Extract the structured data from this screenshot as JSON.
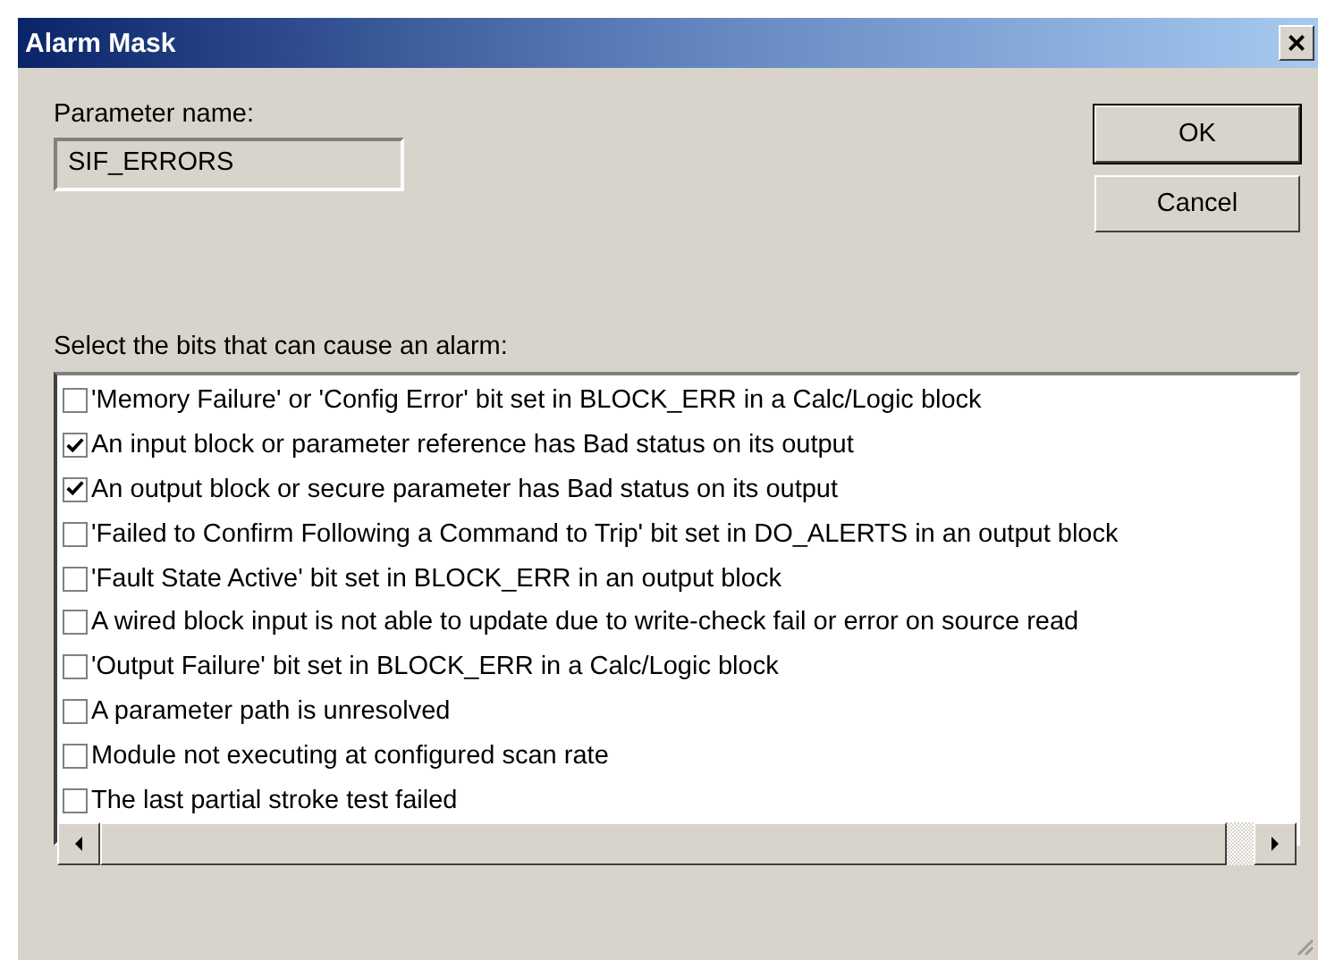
{
  "window": {
    "title": "Alarm Mask",
    "close": "×"
  },
  "parameter": {
    "label": "Parameter name:",
    "value": "SIF_ERRORS"
  },
  "buttons": [
    {
      "label": "OK",
      "default": true
    },
    {
      "label": "Cancel",
      "default": false
    }
  ],
  "bits": {
    "label": "Select the bits that can cause an alarm:",
    "items": [
      {
        "label": "'Memory Failure' or 'Config Error' bit set in BLOCK_ERR in a Calc/Logic block",
        "checked": false
      },
      {
        "label": "An input block or parameter reference has Bad status on its output",
        "checked": true
      },
      {
        "label": "An output block or secure parameter has Bad status on its output",
        "checked": true
      },
      {
        "label": "'Failed to Confirm Following a Command to Trip' bit set in DO_ALERTS in an output block",
        "checked": false
      },
      {
        "label": "'Fault State Active' bit set in BLOCK_ERR in an output block",
        "checked": false
      },
      {
        "label": "A wired block input is not able to update due to write-check fail or error on source read",
        "checked": false
      },
      {
        "label": "'Output Failure' bit set in BLOCK_ERR in a Calc/Logic block",
        "checked": false
      },
      {
        "label": "A parameter path is unresolved",
        "checked": false
      },
      {
        "label": "Module not executing at configured scan rate",
        "checked": false
      },
      {
        "label": "The last partial stroke test failed",
        "checked": false
      }
    ]
  }
}
